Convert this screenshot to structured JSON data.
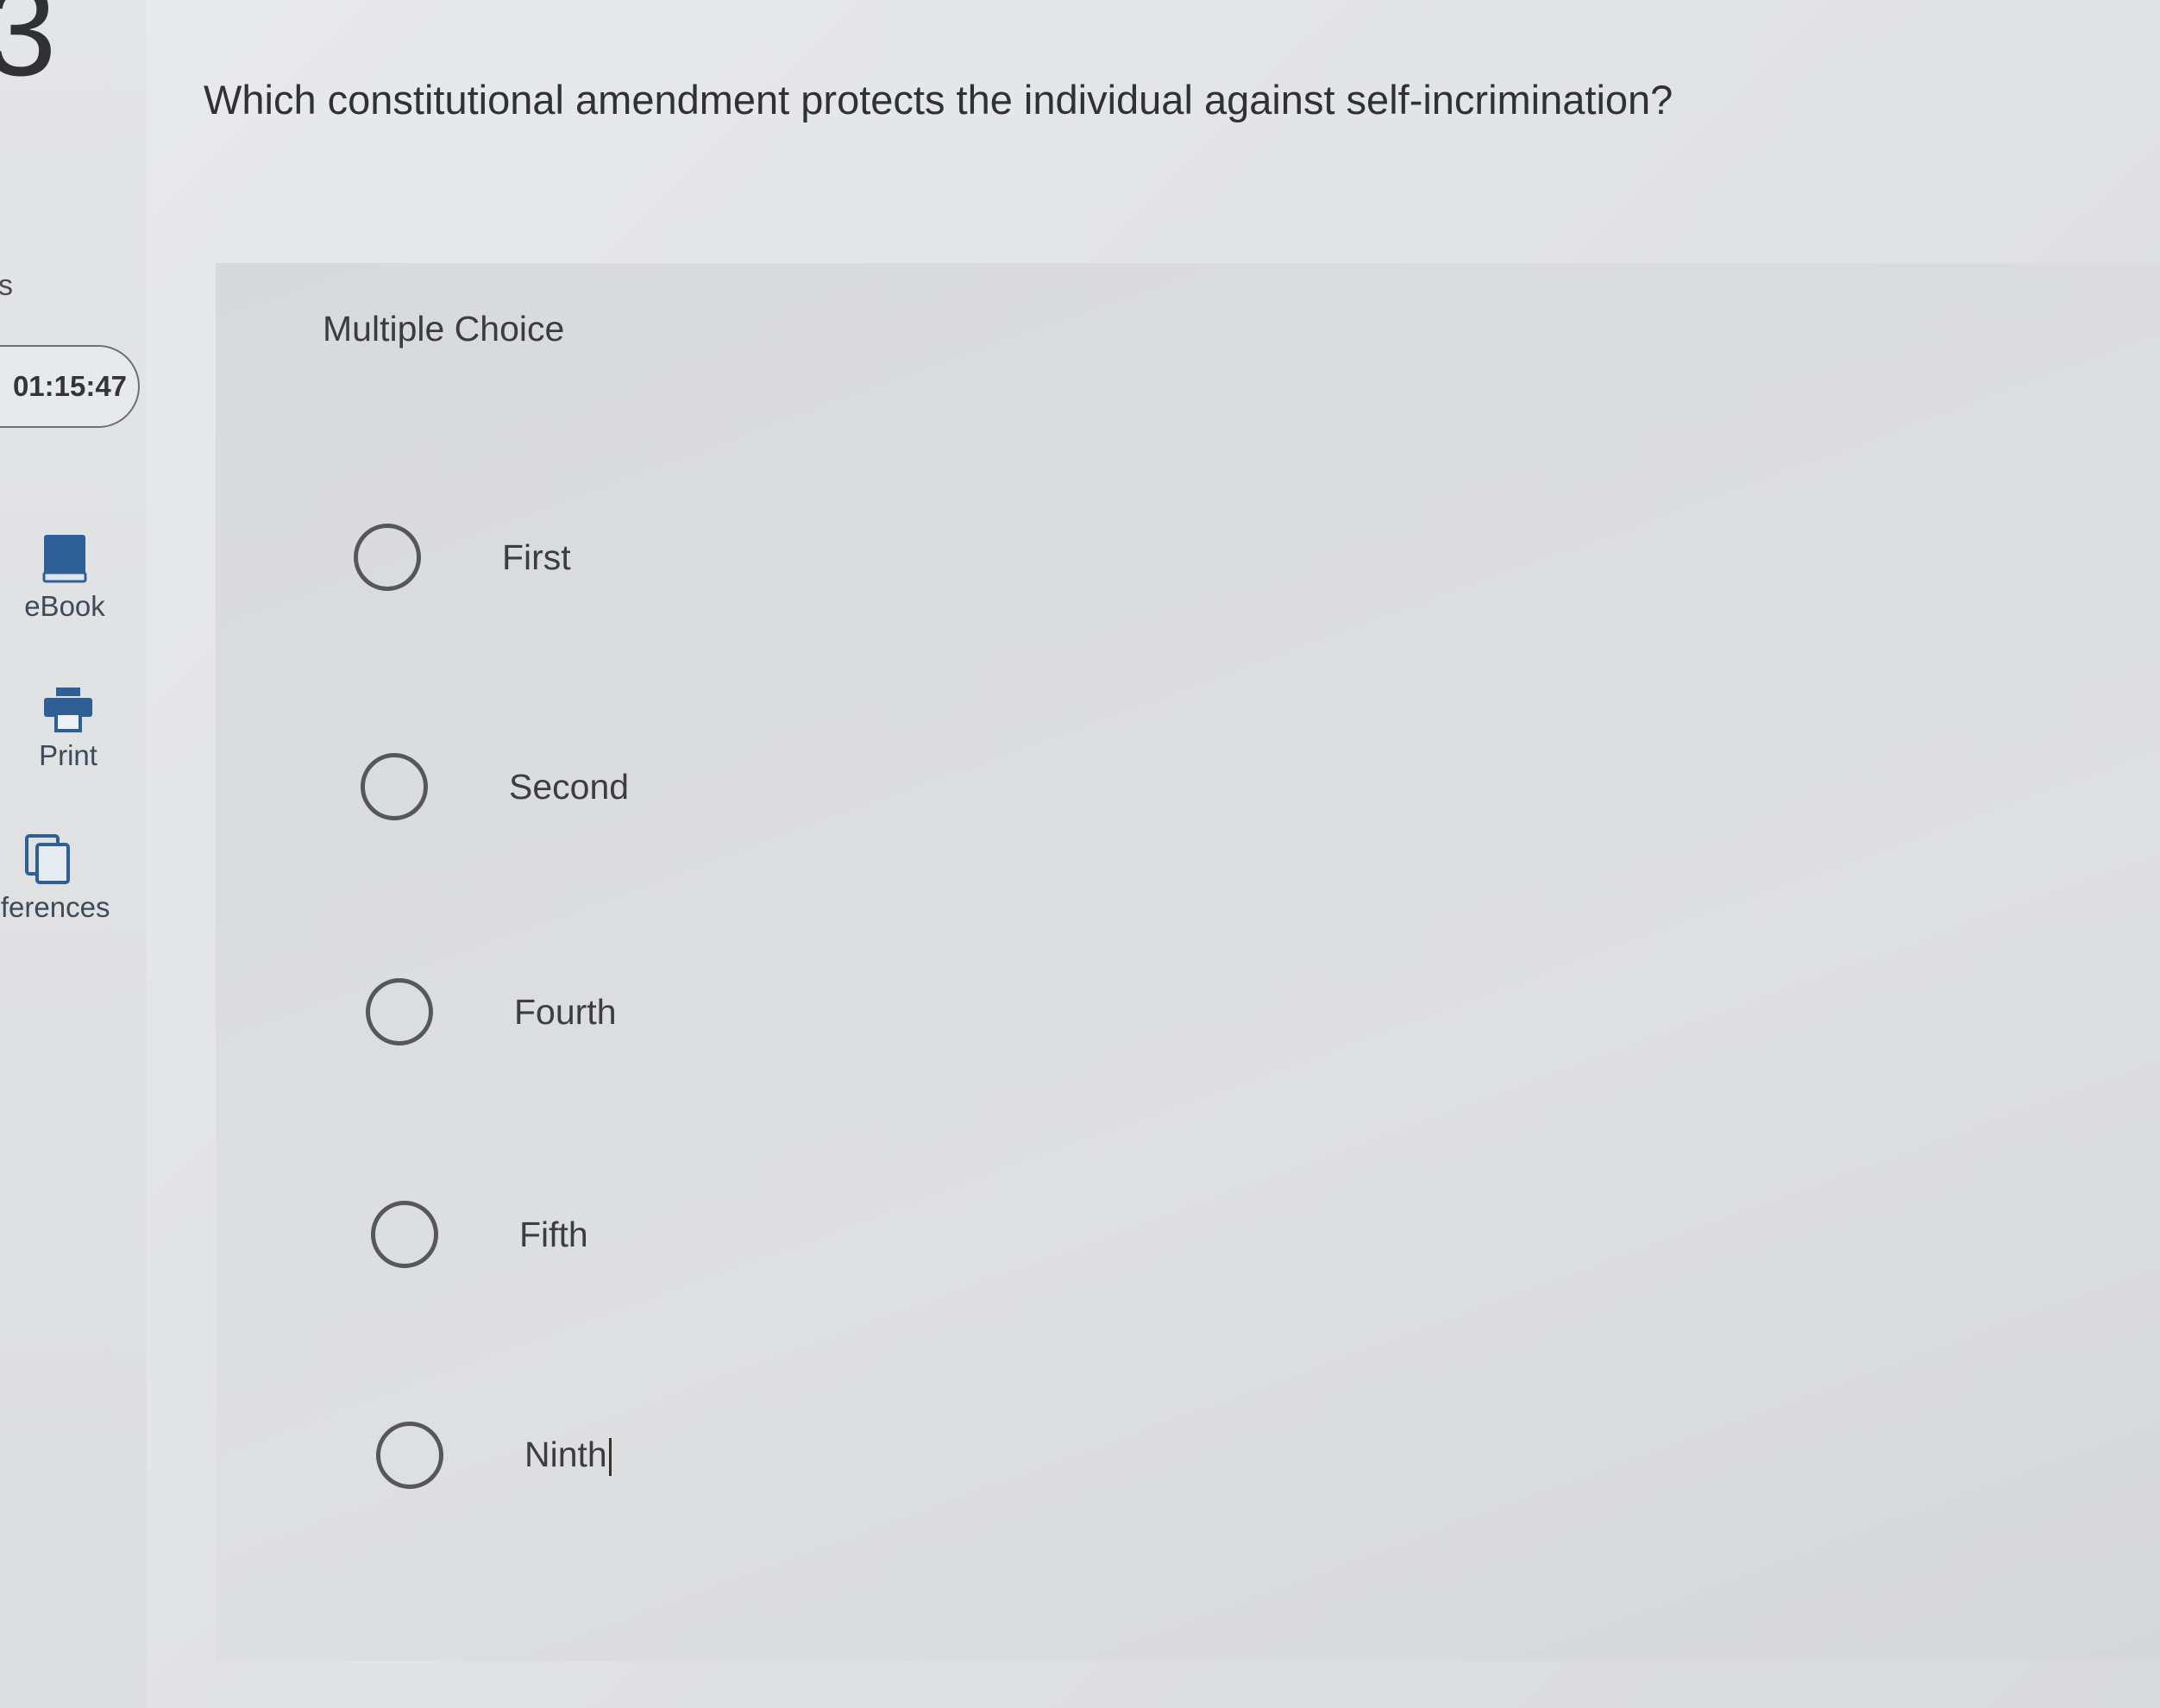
{
  "sidebar": {
    "question_number": "3",
    "partial_label": "s",
    "timer": "01:15:47",
    "tools": [
      {
        "label": "eBook",
        "icon": "ebook-icon"
      },
      {
        "label": "Print",
        "icon": "printer-icon"
      },
      {
        "label": "eferences",
        "icon": "references-icon"
      }
    ]
  },
  "question": {
    "text": "Which constitutional amendment protects the individual against self-incrimination?",
    "type_label": "Multiple Choice",
    "options": [
      "First",
      "Second",
      "Fourth",
      "Fifth",
      "Ninth"
    ]
  },
  "colors": {
    "background": "#e2e3e5",
    "panel": "#dadbdd",
    "text": "#2f3134",
    "icon_blue": "#2f5f97"
  }
}
